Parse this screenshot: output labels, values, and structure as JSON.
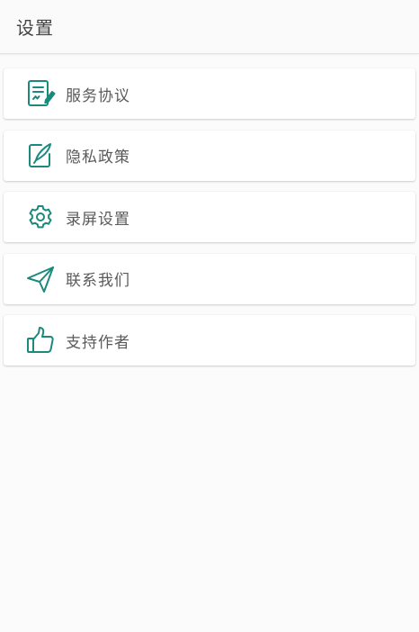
{
  "toolbar": {
    "title": "设置"
  },
  "theme": {
    "accent": "#1b8a7c"
  },
  "menu": {
    "items": [
      {
        "label": "服务协议",
        "icon": "document-sign-icon"
      },
      {
        "label": "隐私政策",
        "icon": "pen-note-icon"
      },
      {
        "label": "录屏设置",
        "icon": "gear-icon"
      },
      {
        "label": "联系我们",
        "icon": "paper-plane-icon"
      },
      {
        "label": "支持作者",
        "icon": "thumbs-up-icon"
      }
    ]
  }
}
